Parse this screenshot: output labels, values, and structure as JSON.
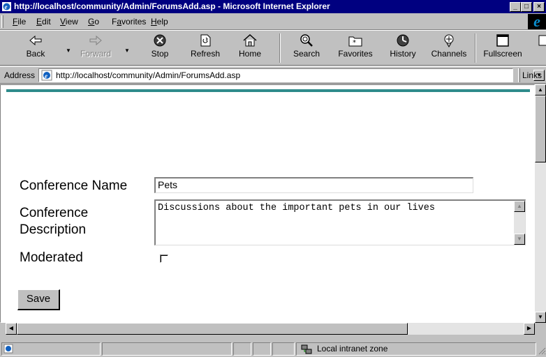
{
  "window": {
    "title": "http://localhost/community/Admin/ForumsAdd.asp - Microsoft Internet Explorer",
    "controls": [
      "minimize",
      "maximize",
      "close"
    ]
  },
  "menu": {
    "items": [
      {
        "key": "F",
        "rest": "ile"
      },
      {
        "key": "E",
        "rest": "dit"
      },
      {
        "key": "V",
        "rest": "iew"
      },
      {
        "key": "G",
        "rest": "o"
      },
      {
        "pre": "F",
        "key": "a",
        "rest": "vorites"
      },
      {
        "key": "H",
        "rest": "elp"
      }
    ]
  },
  "toolbar": {
    "back": "Back",
    "forward": "Forward",
    "stop": "Stop",
    "refresh": "Refresh",
    "home": "Home",
    "search": "Search",
    "favorites": "Favorites",
    "history": "History",
    "channels": "Channels",
    "fullscreen": "Fullscreen"
  },
  "address": {
    "label": "Address",
    "url": "http://localhost/community/Admin/ForumsAdd.asp",
    "links_label": "Links"
  },
  "form": {
    "name_label": "Conference Name",
    "name_value": "Pets",
    "desc_label_line1": "Conference",
    "desc_label_line2": "Description",
    "desc_value": "Discussions about the important pets in our lives",
    "moderated_label": "Moderated",
    "moderated_checked": false,
    "save_label": "Save"
  },
  "status": {
    "zone": "Local intranet zone"
  },
  "colors": {
    "titlebar": "#000080",
    "chrome": "#c0c0c0",
    "accent_bar": "#2e8b8b"
  }
}
